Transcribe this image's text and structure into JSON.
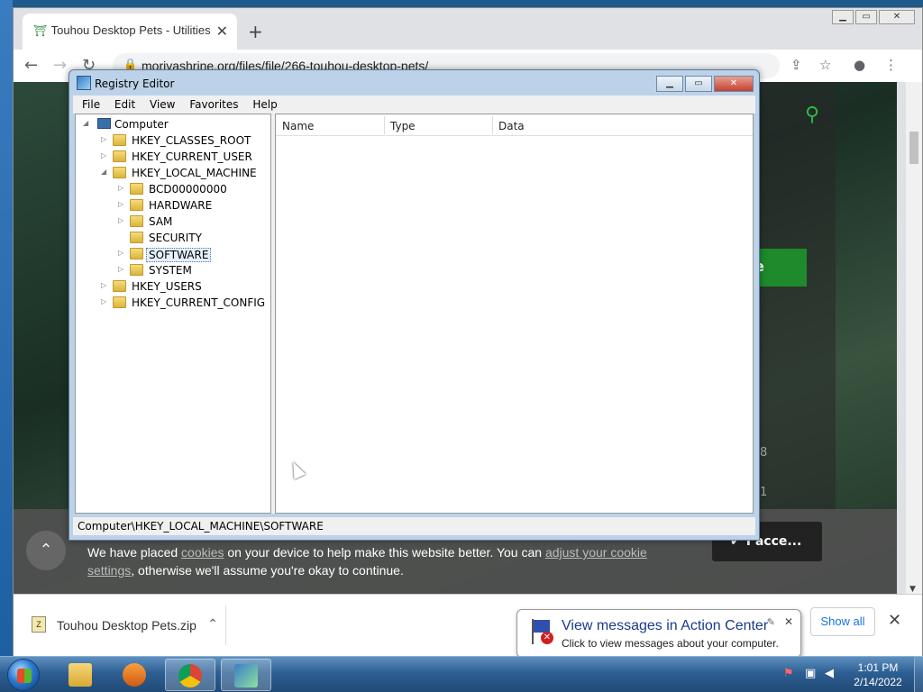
{
  "browser": {
    "tab_title": "Touhou Desktop Pets - Utilities -",
    "url": "moriyashrine.org/files/file/266-touhou-desktop-pets/"
  },
  "page": {
    "green_button": "e",
    "side_numbers": [
      "8",
      "1"
    ]
  },
  "cookie_banner": {
    "text_1": "We have placed ",
    "link_1": "cookies",
    "text_2": " on your device to help make this website better. You can ",
    "link_2": "adjust your cookie settings",
    "text_3": ", otherwise we'll assume you're okay to continue.",
    "accept_label": "I acce..."
  },
  "downloads": {
    "file_name": "Touhou Desktop Pets.zip",
    "show_all_label": "Show all"
  },
  "regedit": {
    "title": "Registry Editor",
    "menu": [
      "File",
      "Edit",
      "View",
      "Favorites",
      "Help"
    ],
    "tree": {
      "root": "Computer",
      "hives": [
        "HKEY_CLASSES_ROOT",
        "HKEY_CURRENT_USER",
        "HKEY_LOCAL_MACHINE"
      ],
      "hklm_children": [
        "BCD00000000",
        "HARDWARE",
        "SAM",
        "SECURITY",
        "SOFTWARE",
        "SYSTEM"
      ],
      "hives_after": [
        "HKEY_USERS",
        "HKEY_CURRENT_CONFIG"
      ]
    },
    "columns": [
      "Name",
      "Type",
      "Data"
    ],
    "status": "Computer\\HKEY_LOCAL_MACHINE\\SOFTWARE"
  },
  "balloon": {
    "title": "View messages in Action Center",
    "text": "Click to view messages about your computer."
  },
  "taskbar": {
    "time": "1:01 PM",
    "date": "2/14/2022"
  },
  "colors": {
    "accept_button_bg": "#222222",
    "page_green": "#1e8a2c",
    "taskbar": "#2e5f92"
  }
}
